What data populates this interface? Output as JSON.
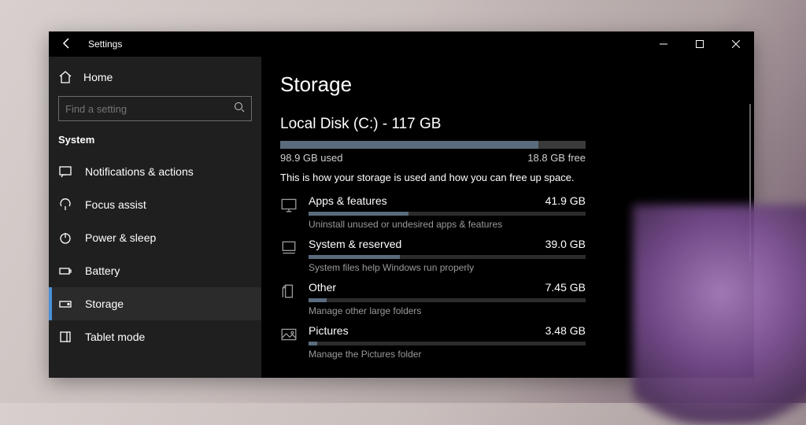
{
  "window": {
    "app_title": "Settings"
  },
  "sidebar": {
    "home": "Home",
    "search_placeholder": "Find a setting",
    "section": "System",
    "items": [
      {
        "label": "Notifications & actions"
      },
      {
        "label": "Focus assist"
      },
      {
        "label": "Power & sleep"
      },
      {
        "label": "Battery"
      },
      {
        "label": "Storage"
      },
      {
        "label": "Tablet mode"
      }
    ],
    "selected_index": 4
  },
  "main": {
    "heading": "Storage",
    "disk": {
      "title": "Local Disk (C:) - 117 GB",
      "used_label": "98.9 GB used",
      "free_label": "18.8 GB free",
      "used_pct": 84.5
    },
    "description": "This is how your storage is used and how you can free up space.",
    "categories": [
      {
        "name": "Apps & features",
        "size": "41.9 GB",
        "pct": 36,
        "sub": "Uninstall unused or undesired apps & features"
      },
      {
        "name": "System & reserved",
        "size": "39.0 GB",
        "pct": 33,
        "sub": "System files help Windows run properly"
      },
      {
        "name": "Other",
        "size": "7.45 GB",
        "pct": 6.4,
        "sub": "Manage other large folders"
      },
      {
        "name": "Pictures",
        "size": "3.48 GB",
        "pct": 3,
        "sub": "Manage the Pictures folder"
      }
    ]
  }
}
